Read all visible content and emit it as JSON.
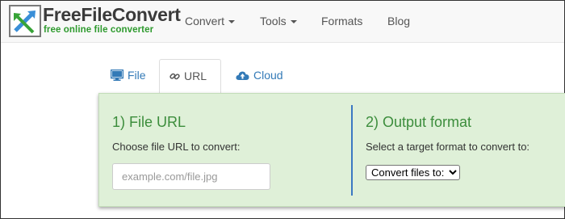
{
  "brand": {
    "title": "FreeFileConvert",
    "subtitle": "free online file converter"
  },
  "nav": {
    "items": [
      {
        "label": "Convert",
        "dropdown": true
      },
      {
        "label": "Tools",
        "dropdown": true
      },
      {
        "label": "Formats",
        "dropdown": false
      },
      {
        "label": "Blog",
        "dropdown": false
      }
    ]
  },
  "tabs": [
    {
      "label": "File",
      "icon": "monitor-icon",
      "active": false
    },
    {
      "label": "URL",
      "icon": "link-icon",
      "active": true
    },
    {
      "label": "Cloud",
      "icon": "cloud-upload-icon",
      "active": false
    }
  ],
  "panel": {
    "section1": {
      "title": "1) File URL",
      "label": "Choose file URL to convert:",
      "input_placeholder": "example.com/file.jpg",
      "input_value": ""
    },
    "section2": {
      "title": "2) Output format",
      "label": "Select a target format to convert to:",
      "select_value": "Convert files to:"
    }
  },
  "colors": {
    "navbar_bg": "#f8f8f8",
    "link_blue": "#337ab7",
    "panel_bg": "#dff0d8",
    "title_green": "#3c8d3c",
    "brand_green": "#2e9a2e",
    "divider_blue": "#3b78c3"
  }
}
